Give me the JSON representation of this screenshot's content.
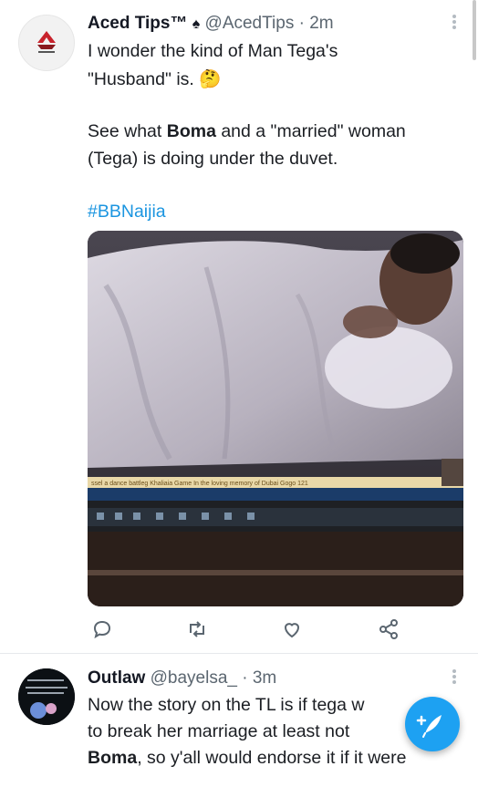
{
  "tweet1": {
    "display_name": "Aced Tips™",
    "handle": "@AcedTips",
    "time": "· 2m",
    "lines": [
      {
        "parts": [
          {
            "text": "I wonder the kind of Man Tega's",
            "bold": false
          }
        ]
      },
      {
        "parts": [
          {
            "text": "\"Husband\" is. 🤔",
            "bold": false
          }
        ]
      },
      {
        "parts": [
          {
            "text": "See what ",
            "bold": false
          },
          {
            "text": "Boma",
            "bold": true
          },
          {
            "text": " and a \"married\" woman",
            "bold": false
          }
        ]
      },
      {
        "parts": [
          {
            "text": "(Tega) is doing under the duvet.",
            "bold": false
          }
        ]
      }
    ],
    "hashtag": "#BBNaijia",
    "media": {
      "ticker_text": "ssel a dance battleg  Khaliaia Game In the loving memory of Dubai Gogo  121"
    }
  },
  "tweet2": {
    "display_name": "Outlaw",
    "handle": "@bayelsa_",
    "time": "· 3m",
    "lines": [
      {
        "parts": [
          {
            "text": "Now the story on the TL is if tega w",
            "bold": false
          }
        ]
      },
      {
        "parts": [
          {
            "text": "to break her marriage at least not ",
            "bold": false
          }
        ]
      },
      {
        "parts": [
          {
            "text": "Boma",
            "bold": true
          },
          {
            "text": ", so y'all would endorse it if it were",
            "bold": false
          }
        ]
      }
    ]
  },
  "icons": {
    "reply": "reply-icon",
    "retweet": "retweet-icon",
    "like": "like-icon",
    "share": "share-icon",
    "menu": "more-vertical-icon",
    "compose": "compose-tweet-icon"
  },
  "colors": {
    "accent": "#1da1f2",
    "hashtag": "#1b95e0",
    "muted": "#5b6670"
  }
}
